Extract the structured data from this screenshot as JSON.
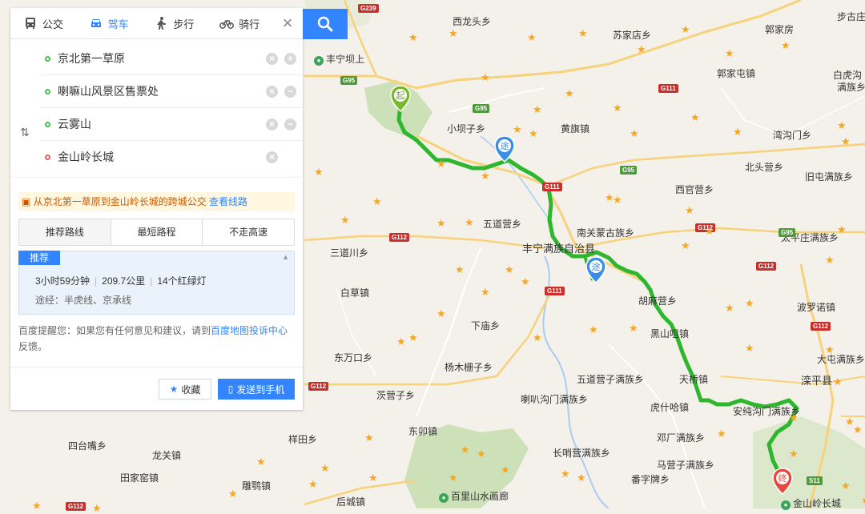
{
  "transport_modes": [
    {
      "label": "公交",
      "icon": "bus-icon"
    },
    {
      "label": "驾车",
      "icon": "car-icon"
    },
    {
      "label": "步行",
      "icon": "walk-icon"
    },
    {
      "label": "骑行",
      "icon": "bike-icon"
    }
  ],
  "waypoints": [
    {
      "label": "京北第一草原"
    },
    {
      "label": "喇嘛山风景区售票处"
    },
    {
      "label": "云雾山"
    },
    {
      "label": "金山岭长城"
    }
  ],
  "notice": {
    "text": "从京北第一草原到金山岭长城的跨城公交",
    "link": "查看线路"
  },
  "route_tabs": [
    "推荐路线",
    "最短路程",
    "不走高速"
  ],
  "plan": {
    "badge": "推荐",
    "duration": "3小时59分钟",
    "distance": "209.7公里",
    "lights": "14个红绿灯",
    "via": "途经：半虎线、京承线"
  },
  "tip": {
    "prefix": "百度提醒您：如果您有任何意见和建议，请到",
    "link": "百度地图投诉中心",
    "suffix": "反馈。"
  },
  "buttons": {
    "save": "收藏",
    "send": "发送到手机"
  },
  "markers": {
    "start": "起",
    "via": "途",
    "end": "终"
  },
  "colors": {
    "route": "#2fb62f",
    "accent": "#3385ff",
    "star": "#f6a623"
  },
  "map": {
    "towns": [
      "西龙头乡",
      "苏家店乡",
      "小坝子乡",
      "黄旗镇",
      "郭家屯镇",
      "湾沟门乡",
      "北头营乡",
      "旧屯满族乡",
      "西官营乡",
      "南关蒙古族乡",
      "五道营乡",
      "三道川乡",
      "白草镇",
      "胡麻营乡",
      "波罗诺镇",
      "下庙乡",
      "黑山咀镇",
      "东万口乡",
      "杨木栅子乡",
      "天桥镇",
      "五道营子满族乡",
      "大屯满族乡",
      "茨营子乡",
      "喇叭沟门满族乡",
      "虎什哈镇",
      "安纯沟门满族乡",
      "邓厂满族乡",
      "东卯镇",
      "四台嘴乡",
      "样田乡",
      "龙关镇",
      "长哨营满族乡",
      "马营子满族乡",
      "番字牌乡",
      "田家窑镇",
      "雕鹗镇",
      "后城镇",
      "太平庄满族乡",
      "郭家房",
      "步古庄",
      "白虎沟",
      "满族乡"
    ],
    "county": [
      "丰宁满族自治县",
      "滦平县"
    ],
    "pois": [
      "丰宁坝上",
      "百里山水画廊",
      "金山岭长城"
    ],
    "roads": [
      "G239",
      "G95",
      "G111",
      "G95",
      "G112",
      "G111",
      "G112",
      "G112",
      "G112",
      "G95",
      "S11",
      "G112"
    ]
  }
}
